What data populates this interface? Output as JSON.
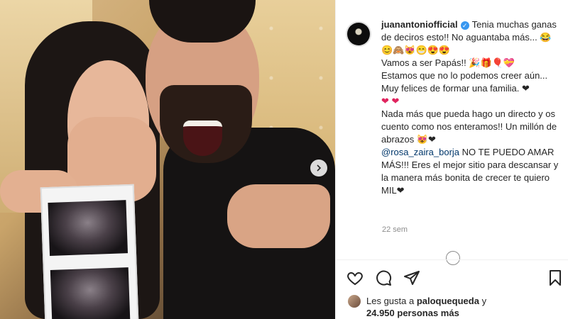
{
  "post": {
    "username": "juanantoniofficial",
    "verified": true,
    "caption_lines": [
      "Tenia muchas ganas de deciros esto!! No aguantaba más... 😂😊🙈😻😁😍😍",
      "Vamos a ser Papás!! 🎉🎁🎈💝",
      "Estamos que no lo podemos creer aún...",
      "Muy felices de formar una familia. ❤",
      "❤ ❤",
      "Nada más que pueda hago un directo y os cuento como nos enteramos!! Un millón de abrazos 😻❤"
    ],
    "mention": "@rosa_zaira_borja",
    "mention_text": " NO TE PUEDO AMAR MÁS!!! Eres el mejor sitio para descansar y la manera más bonita de crecer te quiero MIL❤",
    "time_ago": "22 sem"
  },
  "likes": {
    "prefix": "Les gusta a ",
    "user": "paloquequeda",
    "middle": " y",
    "count": "24.950 personas más"
  },
  "icons": {
    "like": "heart-icon",
    "comment": "comment-icon",
    "share": "send-icon",
    "save": "bookmark-icon",
    "next": "chevron-right-icon",
    "more": "more-icon"
  },
  "colors": {
    "mention": "#00376b",
    "verified": "#3897f0",
    "heart": "#e0245e",
    "time": "#8e8e8e"
  }
}
